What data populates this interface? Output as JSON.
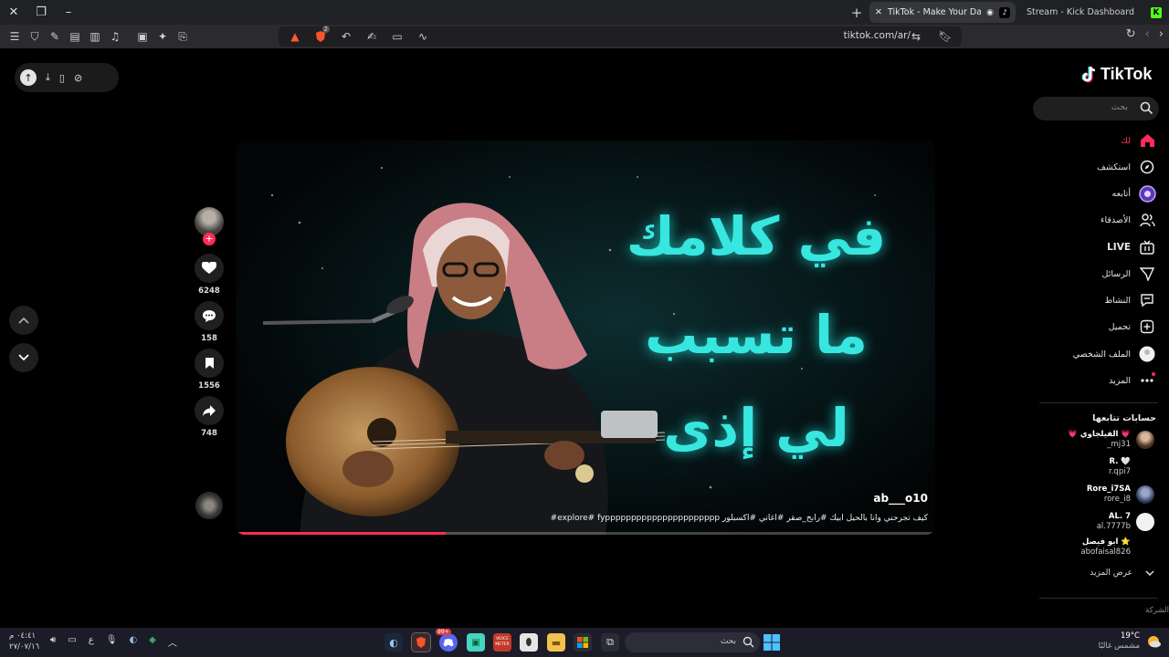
{
  "browser": {
    "tabs": [
      {
        "title": "TikTok - Make Your Day",
        "active": true
      },
      {
        "title": "Stream - Kick Dashboard",
        "active": false
      }
    ],
    "address": "tiktok.com/ar/",
    "badge_count": "2"
  },
  "download_pill": {
    "icons": [
      "download-icon",
      "phone-icon",
      "compass-icon"
    ]
  },
  "video": {
    "username": "ab___o10",
    "caption": "كيف تجرحني وانا بالحيل ابيك #رابح_صقر #اغاني #اكسبلور explore# fypppppppppppppppppppppp#",
    "overlay_lines": [
      "في كلامك",
      "ما تسبب",
      "لي إذى"
    ],
    "progress": 0.3
  },
  "actions": {
    "likes": "6248",
    "comments": "158",
    "bookmarks": "1556",
    "shares": "748"
  },
  "sidebar": {
    "logo": "TikTok",
    "search_placeholder": "بحث",
    "nav": [
      {
        "label": "لك",
        "icon": "home-icon",
        "active": true
      },
      {
        "label": "استكشف",
        "icon": "compass-icon"
      },
      {
        "label": "أتابعه",
        "icon": "following-avatar-icon"
      },
      {
        "label": "الأصدقاء",
        "icon": "friends-icon"
      },
      {
        "label": "LIVE",
        "icon": "live-icon"
      },
      {
        "label": "الرسائل",
        "icon": "messages-icon"
      },
      {
        "label": "النشاط",
        "icon": "activity-icon"
      },
      {
        "label": "تحميل",
        "icon": "upload-icon"
      },
      {
        "label": "الملف الشخصي",
        "icon": "profile-icon"
      },
      {
        "label": "المزيد",
        "icon": "more-icon"
      }
    ],
    "following_title": "حسابات تتابعها",
    "accounts": [
      {
        "name": "💗 الفيلجاوي 💗",
        "handle": "_mj31"
      },
      {
        "name": "R. 🤍",
        "handle": "r.qpi7"
      },
      {
        "name": "Rore_i7SA",
        "handle": "rore_i8"
      },
      {
        "name": "AL. 7",
        "handle": "al.7777b"
      },
      {
        "name": "ابو فيصل ⭐",
        "handle": "abofaisal826"
      }
    ],
    "see_more": "عرض المزيد",
    "company": "الشركة"
  },
  "taskbar": {
    "weather_temp": "19°C",
    "weather_desc": "مشمس غالبًا",
    "search_placeholder": "بحث",
    "time": "٠٤:٤١ م",
    "date": "٢٧/٠٧/١٦",
    "lang": "ع",
    "notification_badge": "99+",
    "voicemeeter_label": "VOICE METER"
  },
  "colors": {
    "accent": "#fe2c55",
    "overlay_text": "#38e6e0",
    "page_bg": "#000000"
  }
}
